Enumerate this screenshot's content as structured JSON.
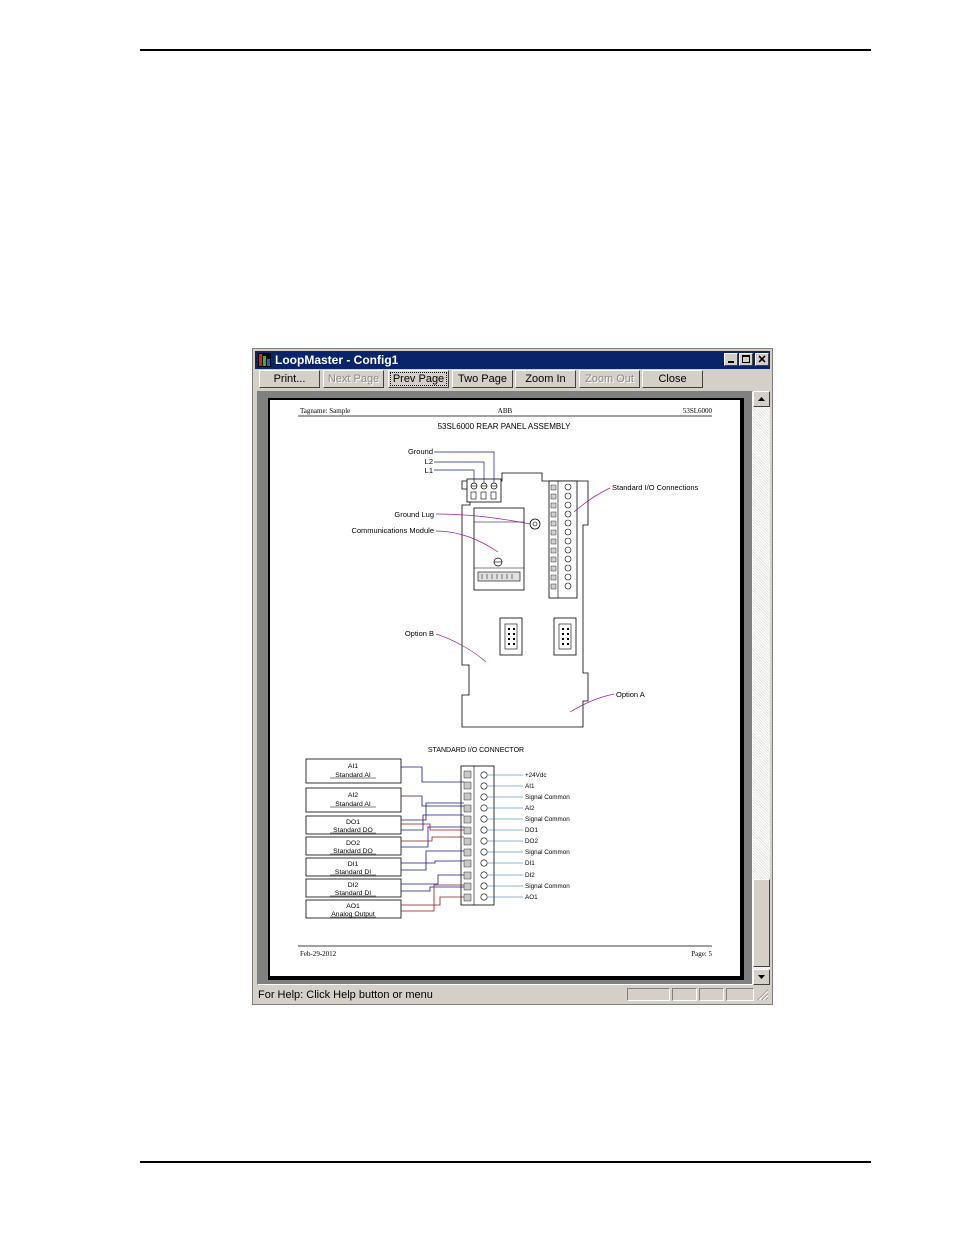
{
  "window": {
    "title": "LoopMaster - Config1"
  },
  "toolbar": {
    "buttons": [
      {
        "label": "Print...",
        "enabled": true
      },
      {
        "label": "Next Page",
        "enabled": false
      },
      {
        "label": "Prev Page",
        "enabled": true
      },
      {
        "label": "Two Page",
        "enabled": true
      },
      {
        "label": "Zoom In",
        "enabled": true
      },
      {
        "label": "Zoom Out",
        "enabled": false
      },
      {
        "label": "Close",
        "enabled": true
      }
    ]
  },
  "sheet": {
    "header": {
      "left": "Tagname: Sample",
      "center": "ABB",
      "right": "53SL6000"
    },
    "title": "53SL6000 REAR PANEL ASSEMBLY",
    "callouts": {
      "ground": "Ground",
      "l2": "L2",
      "l1": "L1",
      "ground_lug": "Ground Lug",
      "comm_module": "Communications Module",
      "std_io": "Standard I/O Connections",
      "option_b": "Option B",
      "option_a": "Option A"
    },
    "connector_title": "STANDARD I/O CONNECTOR",
    "modules": [
      {
        "name": "AI1",
        "type": "Standard AI"
      },
      {
        "name": "AI2",
        "type": "Standard AI"
      },
      {
        "name": "DO1",
        "type": "Standard DO"
      },
      {
        "name": "DO2",
        "type": "Standard DO"
      },
      {
        "name": "DI1",
        "type": "Standard DI"
      },
      {
        "name": "DI2",
        "type": "Standard DI"
      },
      {
        "name": "AO1",
        "type": "Analog Output"
      }
    ],
    "terminals": [
      "+24Vdc",
      "AI1",
      "Signal Common",
      "AI2",
      "Signal Common",
      "DO1",
      "DO2",
      "Signal Common",
      "DI1",
      "DI2",
      "Signal Common",
      "AO1"
    ],
    "footer": {
      "left": "Feb-29-2012",
      "right": "Page: 5"
    }
  },
  "statusbar": {
    "message": "For Help:  Click Help button or menu"
  },
  "colors": {
    "title_bar": "#0a246a",
    "wire_blue": "#1a1a8c",
    "wire_red": "#8c1a1a",
    "wire_magenta": "#a0208a",
    "terminal_line": "#1a6aa0"
  }
}
